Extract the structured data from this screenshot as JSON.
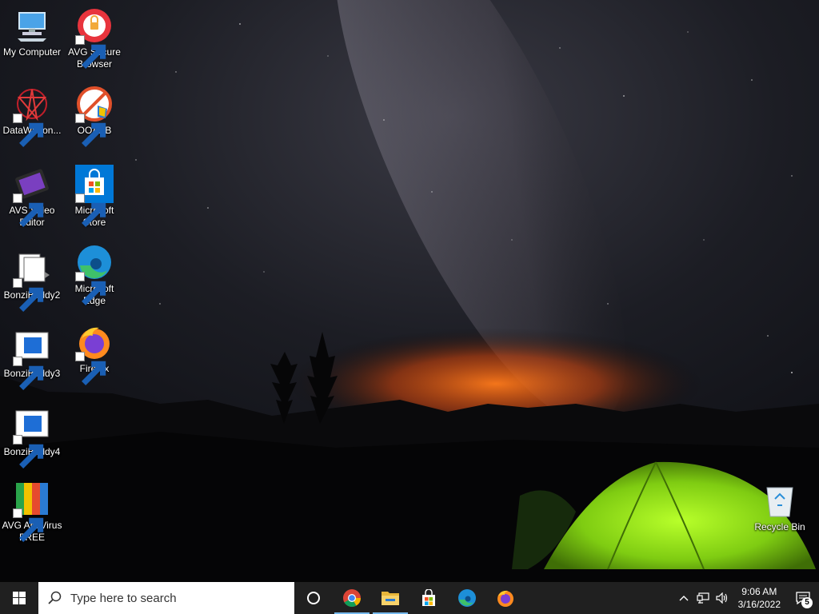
{
  "desktop": {
    "icons_left": [
      {
        "label": "My Computer",
        "icon": "computer-icon"
      },
      {
        "label": "DataWagon...",
        "icon": "datawagon-icon"
      },
      {
        "label": "AVS Video Editor",
        "icon": "avs-video-editor-icon"
      },
      {
        "label": "BonziBuddy2",
        "icon": "bonzibuddy-icon"
      },
      {
        "label": "BonziBuddy3",
        "icon": "bonzibuddy-icon"
      },
      {
        "label": "BonziBuddy4",
        "icon": "bonzibuddy-icon"
      },
      {
        "label": "AVG AntiVirus FREE",
        "icon": "avg-antivirus-icon"
      }
    ],
    "icons_right_col": [
      {
        "label": "AVG Secure Browser",
        "icon": "avg-browser-icon"
      },
      {
        "label": "OOAPB",
        "icon": "ooapb-icon"
      },
      {
        "label": "Microsoft Store",
        "icon": "store-icon"
      },
      {
        "label": "Microsoft Edge",
        "icon": "edge-icon"
      },
      {
        "label": "Firefox",
        "icon": "firefox-icon"
      }
    ],
    "recycle_bin": {
      "label": "Recycle Bin",
      "icon": "recycle-bin-icon"
    }
  },
  "taskbar": {
    "search_placeholder": "Type here to search",
    "pinned": [
      "cortana-icon",
      "chrome-icon",
      "file-explorer-icon",
      "store-icon",
      "edge-icon",
      "firefox-icon"
    ],
    "active": [
      "chrome-icon",
      "file-explorer-icon"
    ],
    "clock": {
      "time": "9:06 AM",
      "date": "3/16/2022"
    },
    "notifications_count": "5",
    "accent": "#76b9ed"
  }
}
